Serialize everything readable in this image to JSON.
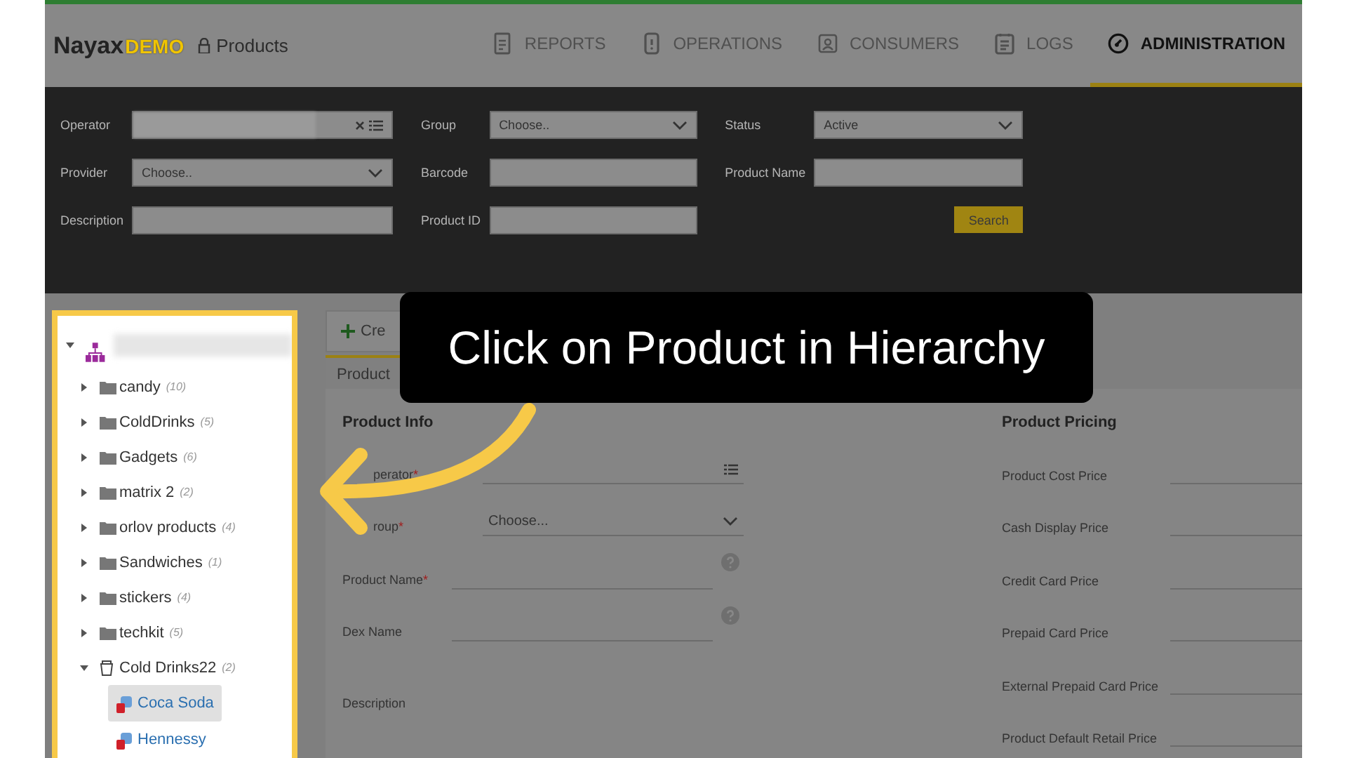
{
  "header": {
    "logo": "Nayax",
    "logo_suffix": "DEMO",
    "page": "Products",
    "nav": [
      {
        "label": "REPORTS",
        "selected": false
      },
      {
        "label": "OPERATIONS",
        "selected": false
      },
      {
        "label": "CONSUMERS",
        "selected": false
      },
      {
        "label": "LOGS",
        "selected": false
      },
      {
        "label": "ADMINISTRATION",
        "selected": true
      }
    ]
  },
  "filters": {
    "fields": [
      {
        "label": "Operator",
        "kind": "picker"
      },
      {
        "label": "Group",
        "kind": "select",
        "value": "Choose.."
      },
      {
        "label": "Status",
        "kind": "select",
        "value": "Active"
      },
      {
        "label": "Provider",
        "kind": "select",
        "value": "Choose.."
      },
      {
        "label": "Barcode",
        "kind": "text"
      },
      {
        "label": "Product Name",
        "kind": "text"
      },
      {
        "label": "Description",
        "kind": "text"
      },
      {
        "label": "Product ID",
        "kind": "text"
      }
    ],
    "search_button": "Search"
  },
  "tree": {
    "expanded": true,
    "children": [
      {
        "name": "candy",
        "count": "(10)",
        "kind": "folder",
        "expanded": false
      },
      {
        "name": "ColdDrinks",
        "count": "(5)",
        "kind": "folder",
        "expanded": false
      },
      {
        "name": "Gadgets",
        "count": "(6)",
        "kind": "folder",
        "expanded": false
      },
      {
        "name": "matrix 2",
        "count": "(2)",
        "kind": "folder",
        "expanded": false
      },
      {
        "name": "orlov products",
        "count": "(4)",
        "kind": "folder",
        "expanded": false
      },
      {
        "name": "Sandwiches",
        "count": "(1)",
        "kind": "folder",
        "expanded": false
      },
      {
        "name": "stickers",
        "count": "(4)",
        "kind": "folder",
        "expanded": false
      },
      {
        "name": "techkit",
        "count": "(5)",
        "kind": "folder",
        "expanded": false
      },
      {
        "name": "Cold Drinks22",
        "count": "(2)",
        "kind": "group",
        "expanded": true,
        "children": [
          {
            "name": "Coca Soda",
            "selected": true
          },
          {
            "name": "Hennessy",
            "selected": false
          }
        ]
      }
    ]
  },
  "toolbar": {
    "create_button": "Cre"
  },
  "tab": "Product",
  "required_mark": "*",
  "info": {
    "title": "Product Info",
    "fields": [
      {
        "label": "perator",
        "required": true,
        "kind": "picker"
      },
      {
        "label": "roup",
        "required": true,
        "kind": "select",
        "value": "Choose..."
      },
      {
        "label": "Product Name",
        "required": true,
        "kind": "text",
        "help": true
      },
      {
        "label": "Dex Name",
        "required": false,
        "kind": "text",
        "help": true
      },
      {
        "label": "Description",
        "required": false,
        "kind": "textarea"
      }
    ]
  },
  "pricing": {
    "title": "Product Pricing",
    "fields": [
      "Product Cost Price",
      "Cash Display Price",
      "Credit Card Price",
      "Prepaid Card Price",
      "External Prepaid Card Price",
      "Product Default Retail Price"
    ]
  },
  "callout": {
    "text": "Click on Product in Hierarchy"
  }
}
